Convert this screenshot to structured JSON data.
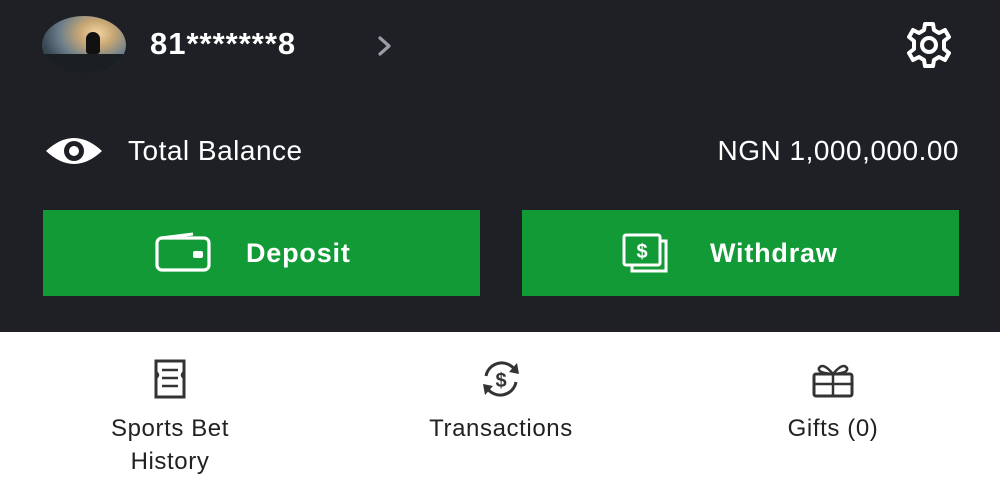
{
  "header": {
    "user_id": "81*******8"
  },
  "balance": {
    "label": "Total Balance",
    "amount": "NGN 1,000,000.00"
  },
  "actions": {
    "deposit_label": "Deposit",
    "withdraw_label": "Withdraw"
  },
  "shortcuts": {
    "history_line1": "Sports Bet",
    "history_line2": "History",
    "transactions_label": "Transactions",
    "gifts_label": "Gifts (0)"
  },
  "icons": {
    "avatar": "avatar-photo",
    "chevron": "chevron-right-icon",
    "settings": "gear-icon",
    "visibility": "eye-icon",
    "deposit": "wallet-icon",
    "withdraw": "cash-icon",
    "history": "receipt-icon",
    "transactions": "currency-exchange-icon",
    "gifts": "gift-icon"
  },
  "colors": {
    "header_bg": "#1e2026",
    "button_green": "#129a37",
    "text_light": "#ffffff",
    "text_dark": "#222222"
  }
}
